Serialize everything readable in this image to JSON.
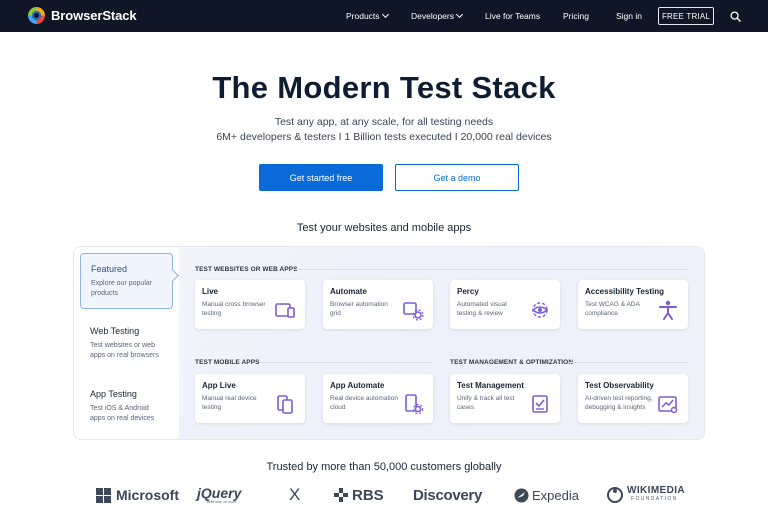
{
  "nav": {
    "brand": "BrowserStack",
    "items": [
      {
        "label": "Products",
        "dropdown": true
      },
      {
        "label": "Developers",
        "dropdown": true
      },
      {
        "label": "Live for Teams",
        "dropdown": false
      },
      {
        "label": "Pricing",
        "dropdown": false
      },
      {
        "label": "Sign in",
        "dropdown": false
      }
    ],
    "cta": "FREE TRIAL"
  },
  "hero": {
    "title": "The Modern Test Stack",
    "subtitle_1": "Test any app, at any scale, for all testing needs",
    "subtitle_2": "6M+ developers & testers I 1 Billion tests executed I 20,000 real devices",
    "primary_cta": "Get started free",
    "secondary_cta": "Get a demo"
  },
  "products": {
    "section_title": "Test your websites and mobile apps",
    "sidebar": [
      {
        "title": "Featured",
        "desc": "Explore our popular products",
        "active": true
      },
      {
        "title": "Web Testing",
        "desc": "Test websites or web apps on real browsers",
        "active": false
      },
      {
        "title": "App Testing",
        "desc": "Test iOS & Android apps on real devices",
        "active": false
      }
    ],
    "groups": {
      "web": "TEST WEBSITES OR WEB APPS",
      "mobile": "TEST MOBILE APPS",
      "mgmt": "TEST MANAGEMENT & OPTIMIZATION"
    },
    "cards": [
      {
        "title": "Live",
        "desc": "Manual cross browser testing",
        "icon": "browser-window-icon"
      },
      {
        "title": "Automate",
        "desc": "Browser automation grid",
        "icon": "browser-gear-icon"
      },
      {
        "title": "Percy",
        "desc": "Automated visual testing & review",
        "icon": "eye-gear-icon"
      },
      {
        "title": "Accessibility Testing",
        "desc": "Test WCAG & ADA compliance",
        "icon": "accessibility-person-icon"
      },
      {
        "title": "App Live",
        "desc": "Manual real device testing",
        "icon": "mobile-devices-icon"
      },
      {
        "title": "App Automate",
        "desc": "Real device automation cloud",
        "icon": "mobile-gear-icon"
      },
      {
        "title": "Test Management",
        "desc": "Unify & track all test cases",
        "icon": "checklist-icon"
      },
      {
        "title": "Test Observability",
        "desc": "AI-driven test reporting, debugging & insights",
        "icon": "chart-insight-icon"
      }
    ]
  },
  "trusted": {
    "title": "Trusted by more than 50,000 customers globally",
    "logos": [
      "Microsoft",
      "jQuery",
      "X",
      "RBS",
      "Discovery",
      "Expedia",
      "WIKIMEDIA"
    ],
    "wikimedia_sub": "FOUNDATION",
    "jquery_sub": "write less, do more."
  },
  "colors": {
    "nav_bg": "#0f1625",
    "primary": "#0a6bd8",
    "icon_purple": "#7b5cd6",
    "heading": "#0f1d33"
  }
}
